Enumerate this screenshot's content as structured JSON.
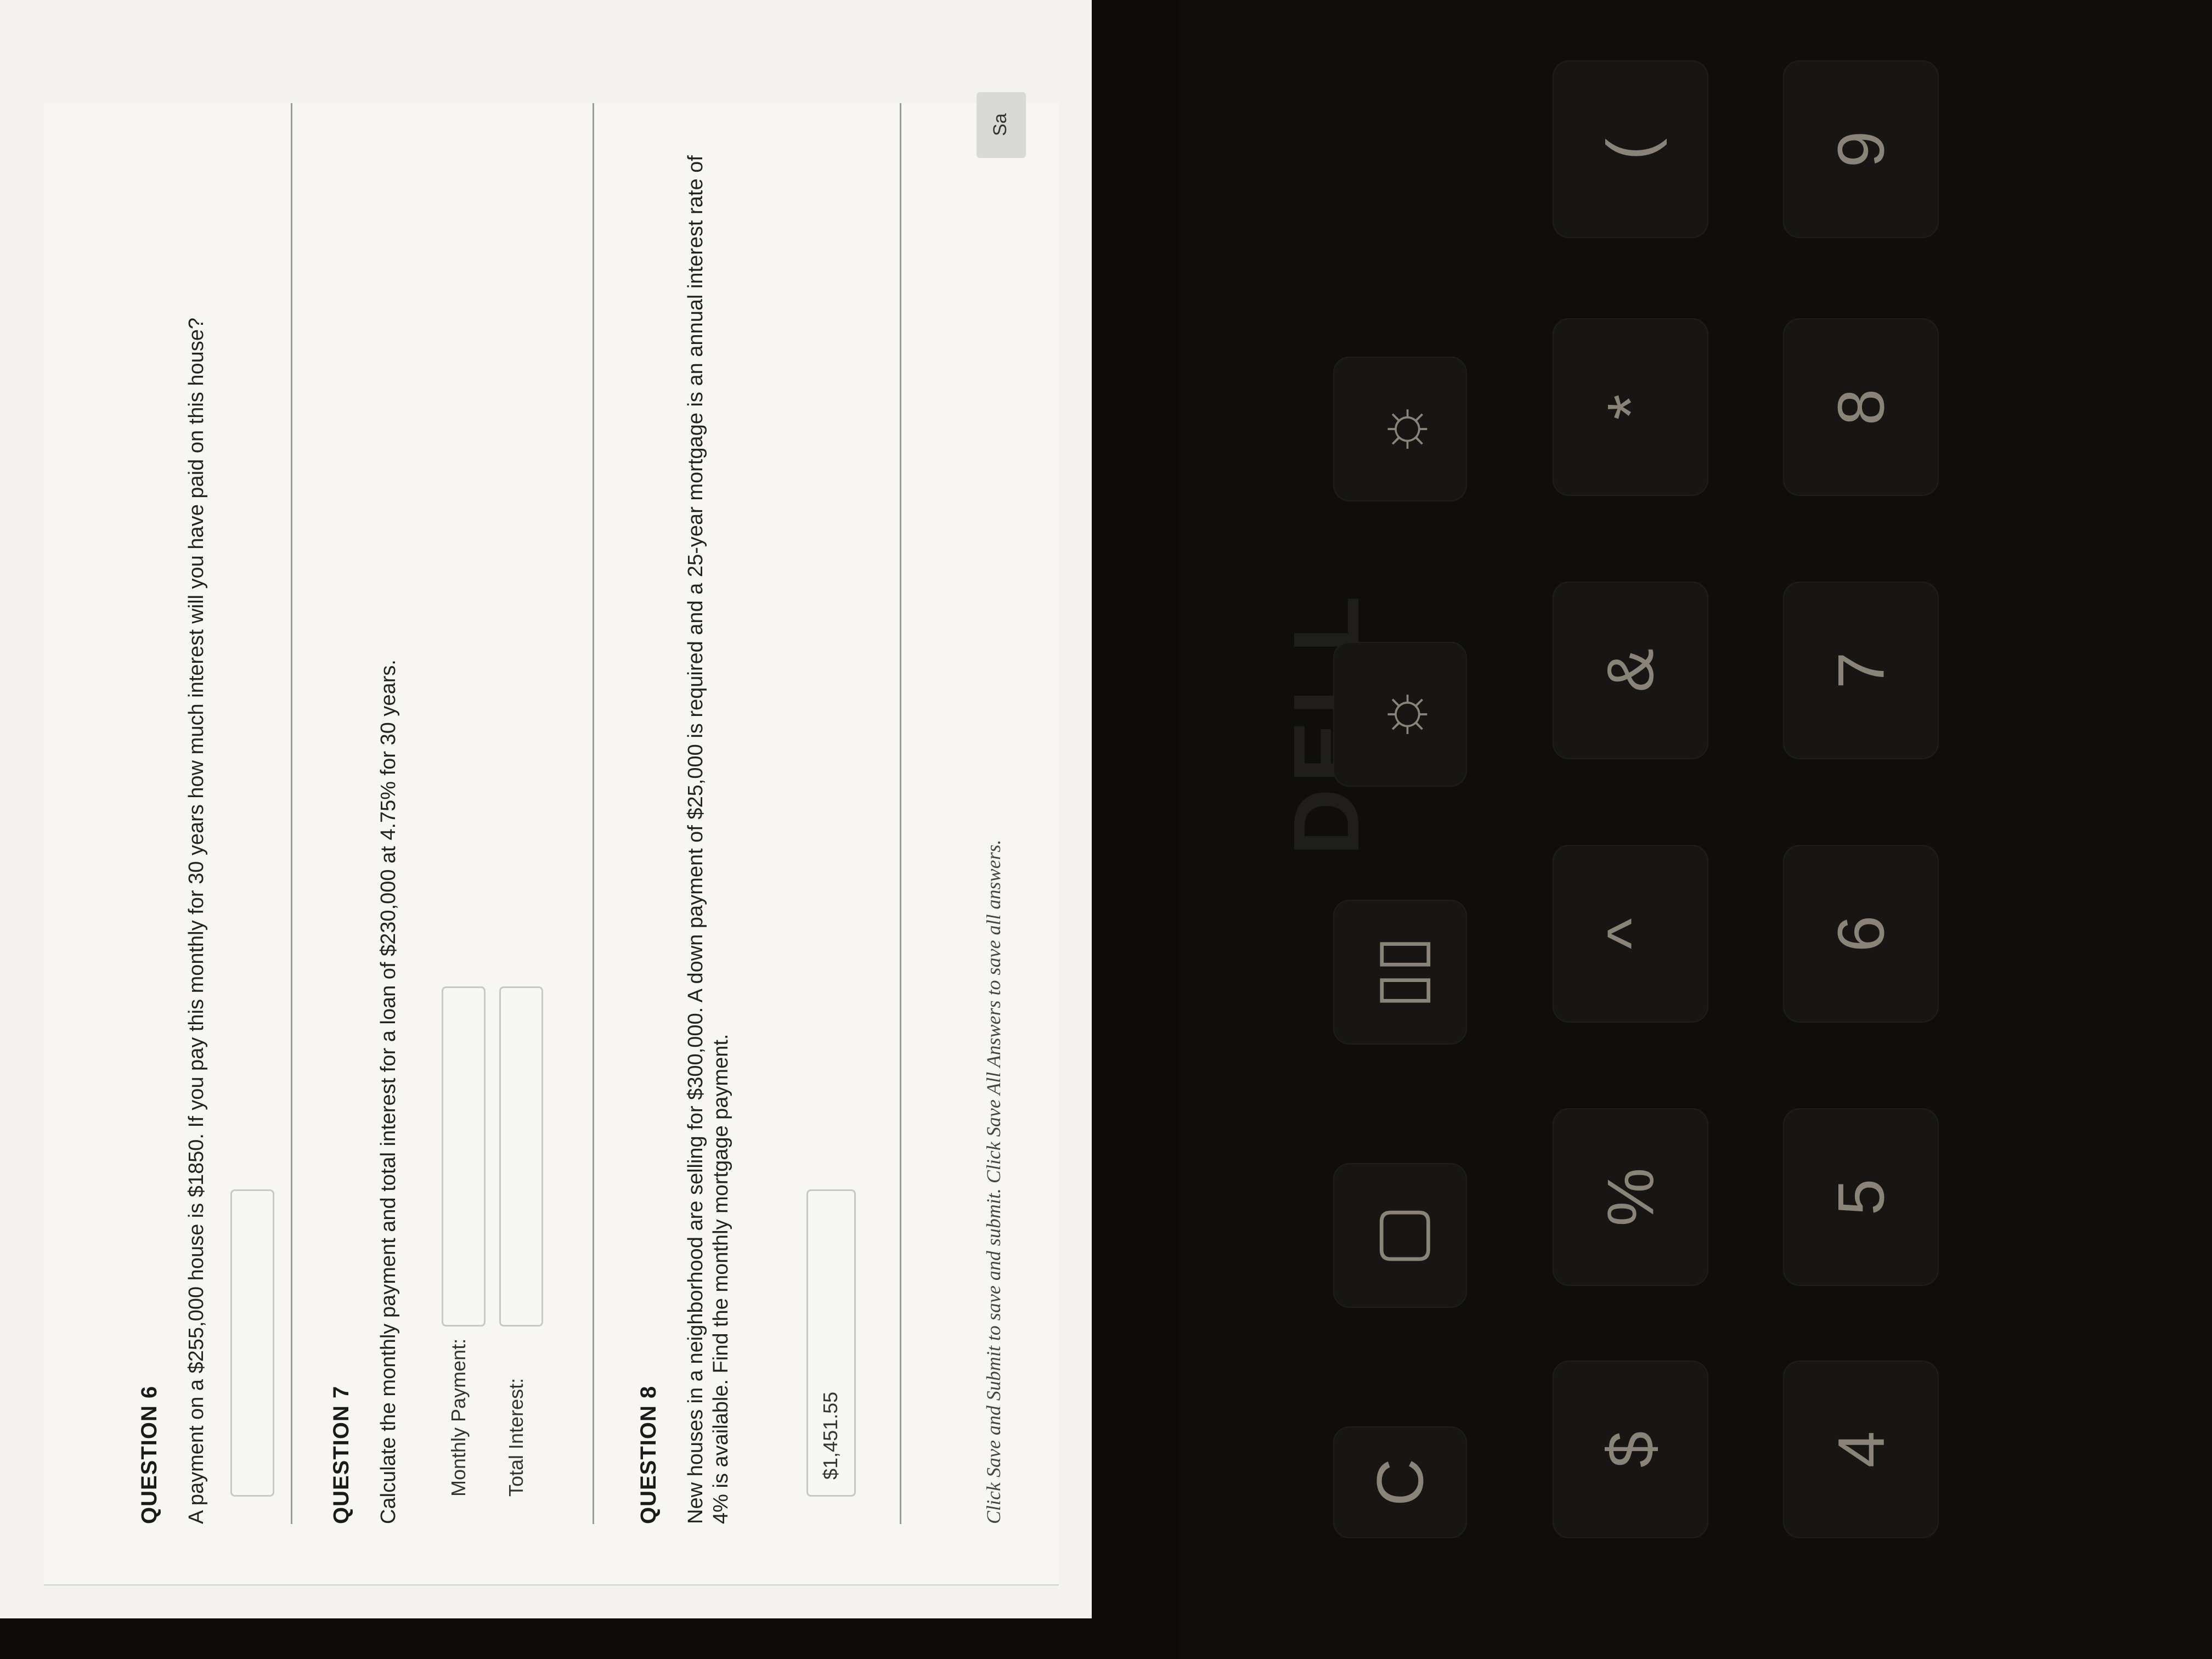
{
  "questions": [
    {
      "title": "QUESTION 6",
      "text": "A payment on a $255,000 house is $1850. If you pay this monthly for 30 years how much interest will you have paid on this house?",
      "answer": ""
    },
    {
      "title": "QUESTION 7",
      "text": "Calculate the monthly payment and total interest for a loan of $230,000 at 4.75% for 30 years.",
      "fields": [
        {
          "label": "Monthly Payment:",
          "value": ""
        },
        {
          "label": "Total Interest:",
          "value": ""
        }
      ]
    },
    {
      "title": "QUESTION 8",
      "text": "New houses in a neighborhood are selling for $300,000. A down payment of $25,000 is required and a 25-year mortgage is an annual interest rate of 4% is available. Find the monthly mortgage payment.",
      "answer": "$1,451.55"
    }
  ],
  "footer": {
    "note": "Click Save and Submit to save and submit. Click Save All Answers to save all answers.",
    "save_label": "Sa"
  },
  "taskbar": {
    "icons": [
      "camera-app-icon",
      "chrome-icon"
    ]
  },
  "device": {
    "brand": "DELL"
  },
  "keyboard": {
    "top_row": [
      "C",
      "▢",
      "▯▯",
      "☼",
      "☼"
    ],
    "symbol_row": [
      "$",
      "%",
      "^",
      "&",
      "*",
      "("
    ],
    "number_row": [
      "4",
      "5",
      "6",
      "7",
      "8",
      "9"
    ]
  },
  "colors": {
    "taskbar": "#352f86",
    "page": "#f7f6f2"
  }
}
